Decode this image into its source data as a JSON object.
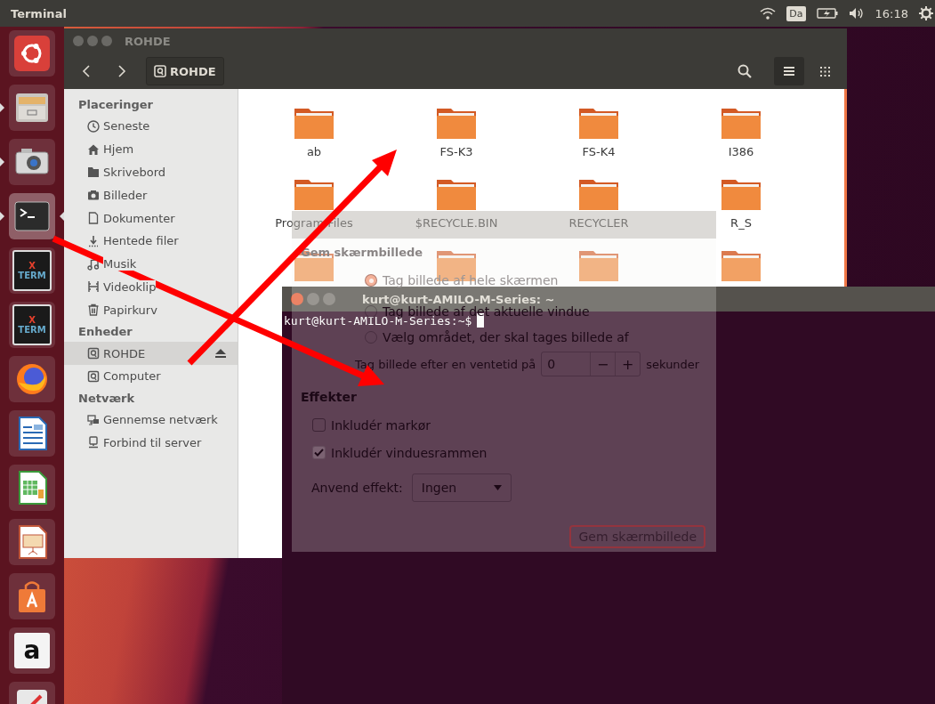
{
  "top_panel": {
    "app_title": "Terminal",
    "keyboard": "Da",
    "time": "16:18"
  },
  "launcher": {
    "items": [
      {
        "kind": "dash",
        "running": false,
        "focused": false
      },
      {
        "kind": "files",
        "running": true,
        "focused": false
      },
      {
        "kind": "camera",
        "running": true,
        "focused": false
      },
      {
        "kind": "terminal",
        "running": true,
        "focused": true
      },
      {
        "kind": "xterm",
        "running": false,
        "focused": false,
        "logo_lines": [
          "X",
          "TERM"
        ]
      },
      {
        "kind": "xterm",
        "running": false,
        "focused": false,
        "logo_lines": [
          "X",
          "TERM"
        ]
      },
      {
        "kind": "browser",
        "running": false,
        "focused": false
      },
      {
        "kind": "writer",
        "running": false,
        "focused": false
      },
      {
        "kind": "calc",
        "running": false,
        "focused": false
      },
      {
        "kind": "impress",
        "running": false,
        "focused": false
      },
      {
        "kind": "store",
        "running": false,
        "focused": false
      },
      {
        "kind": "amazon",
        "running": false,
        "focused": false,
        "logo_lines": [
          "a"
        ]
      },
      {
        "kind": "tool",
        "running": false,
        "focused": false
      }
    ]
  },
  "files_window": {
    "title": "ROHDE",
    "path": "ROHDE",
    "view_buttons": [
      {
        "kind": "list",
        "selected": true
      },
      {
        "kind": "grid",
        "selected": false
      }
    ],
    "sidebar": [
      {
        "heading": "Placeringer",
        "items": [
          {
            "label": "Seneste",
            "kind": "recent",
            "selected": false
          },
          {
            "label": "Hjem",
            "kind": "home",
            "selected": false
          },
          {
            "label": "Skrivebord",
            "kind": "folder",
            "selected": false
          },
          {
            "label": "Billeder",
            "kind": "camera",
            "selected": false
          },
          {
            "label": "Dokumenter",
            "kind": "document",
            "selected": false
          },
          {
            "label": "Hentede filer",
            "kind": "download",
            "selected": false
          },
          {
            "label": "Musik",
            "kind": "music",
            "selected": false
          },
          {
            "label": "Videoklip",
            "kind": "film",
            "selected": false
          },
          {
            "label": "Papirkurv",
            "kind": "trash",
            "selected": false
          }
        ]
      },
      {
        "heading": "Enheder",
        "items": [
          {
            "label": "ROHDE",
            "kind": "drive",
            "selected": true,
            "ejectable": true
          },
          {
            "label": "Computer",
            "kind": "drive",
            "selected": false,
            "ejectable": false
          }
        ]
      },
      {
        "heading": "Netværk",
        "items": [
          {
            "label": "Gennemse netværk",
            "kind": "network",
            "selected": false
          },
          {
            "label": "Forbind til server",
            "kind": "server",
            "selected": false
          }
        ]
      }
    ],
    "folders": [
      {
        "name": "ab"
      },
      {
        "name": "FS-K3"
      },
      {
        "name": "FS-K4"
      },
      {
        "name": "I386"
      },
      {
        "name": "Program Files"
      },
      {
        "name": "$RECYCLE.BIN"
      },
      {
        "name": "RECYCLER"
      },
      {
        "name": "R_S"
      },
      {
        "covered": true
      },
      {
        "covered": true
      },
      {
        "covered": true
      },
      {
        "covered": true
      }
    ]
  },
  "terminal": {
    "title": "kurt@kurt-AMILO-M-Series: ~",
    "prompt": "kurt@kurt-AMILO-M-Series:~$"
  },
  "screenshot_dialog": {
    "heading": "Gem skærmbillede",
    "options": [
      {
        "label": "Tag billede af hele skærmen",
        "selected": true
      },
      {
        "label": "Tag billede af det aktuelle vindue",
        "selected": false
      },
      {
        "label": "Vælg området, der skal tages billede af",
        "selected": false
      }
    ],
    "delay": {
      "label": "Tag billede efter en ventetid på",
      "value": "0",
      "minus": "−",
      "plus": "+",
      "unit": "sekunder"
    },
    "effects_heading": "Effekter",
    "checkboxes": [
      {
        "label": "Inkludér markør",
        "checked": false,
        "disabled": false
      },
      {
        "label": "Inkludér vinduesrammen",
        "checked": true,
        "disabled": true
      }
    ],
    "effect": {
      "label": "Anvend effekt:",
      "value": "Ingen"
    },
    "button": "Gem skærmbillede"
  }
}
